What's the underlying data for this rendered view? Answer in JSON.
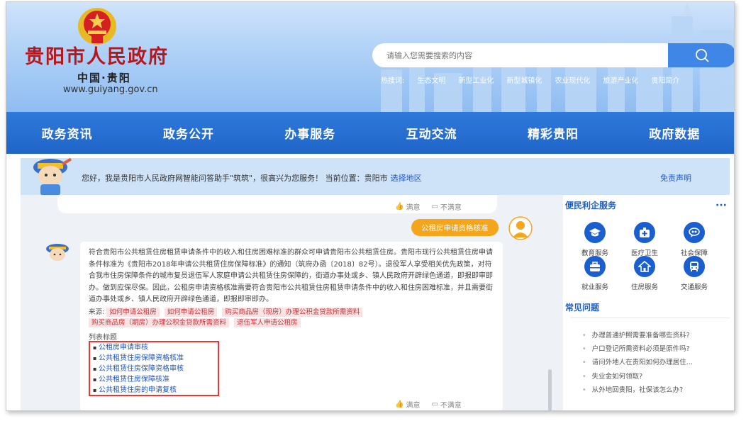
{
  "header": {
    "site_title": "贵阳市人民政府",
    "site_sub": "中国·贵阳",
    "site_url": "www.guiyang.gov.cn"
  },
  "search": {
    "placeholder": "请输入您需要搜索的内容",
    "hot_label": "热搜词:",
    "hot_words": [
      "生态文明",
      "新型工业化",
      "新型城镇化",
      "农业现代化",
      "旅游产业化",
      "贵阳简介"
    ]
  },
  "nav": {
    "items": [
      "政务资讯",
      "政务公开",
      "办事服务",
      "互动交流",
      "精彩贵阳",
      "政府数据"
    ]
  },
  "assistant": {
    "greeting": "您好，我是贵阳市人民政府网智能问答助手\"筑筑\"，很高兴为您服务！ 当前位置：贵阳市",
    "region_link": "选择地区",
    "disclaimer": "免责声明"
  },
  "chat": {
    "feedback_yes": "满意",
    "feedback_no": "不满意",
    "user_message": "公租房申请资格核准",
    "answer_text": "符合贵阳市公共租赁住房租赁申请条件中的收入和住房困难标准的群众可申请贵阳市公共租赁住房。贵阳市现行公共租赁住房申请条件标准为《贵阳市2018年申请公共租赁住房保障标准》的通知（筑府办函〔2018〕82号）。退役军人享受相关优先政策，对符合我市住房保障条件的城市复员退伍军人家庭申请公共租赁住房保障的，街道办事处或乡、镇人民政府开辟绿色通道，即报即审即办。做到应保尽保。因此，公租房申请资格核准需要符合贵阳市公共租赁住房租赁申请条件中的收入和住房困难标准，并且需要街道办事处或乡、镇人民政府开辟绿色通道，即报即审即办。",
    "source_label": "来源:",
    "sources": [
      "如何申请公租房",
      "如何申请公租房",
      "购买商品房（现房）办理公积金贷款所需资料",
      "购买商品房（期房）办理公积金贷款所需资料",
      "退伍军人申请公租房"
    ],
    "list_title": "列表标题",
    "list_items": [
      "公租房申请审核",
      "公共租赁住房保障资格核准",
      "公共租赁住房保障资格审核",
      "公共租赁住房保障核准",
      "公共租赁住房的申请复核"
    ]
  },
  "services": {
    "title": "便民利企服务",
    "more": "···",
    "items": [
      {
        "label": "教育服务",
        "icon": "graduation-cap-icon"
      },
      {
        "label": "医疗卫生",
        "icon": "medical-kit-icon"
      },
      {
        "label": "社会保障",
        "icon": "social-security-icon"
      },
      {
        "label": "就业服务",
        "icon": "briefcase-icon"
      },
      {
        "label": "住房服务",
        "icon": "house-icon"
      },
      {
        "label": "交通服务",
        "icon": "bus-icon"
      }
    ]
  },
  "faq": {
    "title": "常见问题",
    "items": [
      "办理普通护照需要准备哪些资料?",
      "户口登记所需资料必须是原件吗?",
      "请问外地人在贵阳如何办理居住…",
      "失业金如何领取?",
      "从外地回贵阳，社保该怎么办?"
    ]
  },
  "colors": {
    "title_red": "#b5171c",
    "nav_blue": "#2f79db",
    "link_blue": "#1a55c6",
    "user_bubble": "#f4a51c",
    "highlight_box": "#e53935"
  }
}
